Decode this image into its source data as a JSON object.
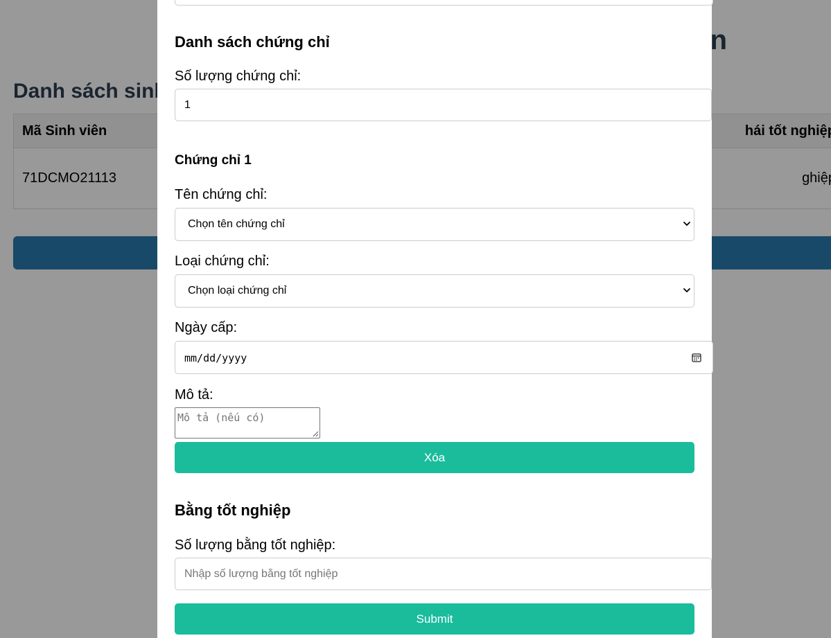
{
  "background": {
    "page_title_fragment": "n",
    "list_title_fragment": "Danh sách sinh",
    "table": {
      "headers": [
        "Mã Sinh viên",
        "hái tốt nghiệp"
      ],
      "rows": [
        [
          "71DCMO21113",
          "ghiệp"
        ]
      ]
    }
  },
  "modal": {
    "certificates": {
      "heading": "Danh sách chứng chỉ",
      "count_label": "Số lượng chứng chỉ:",
      "count_value": "1",
      "item": {
        "heading": "Chứng chỉ 1",
        "name_label": "Tên chứng chỉ:",
        "name_select": "Chọn tên chứng chỉ",
        "type_label": "Loại chứng chỉ:",
        "type_select": "Chọn loại chứng chỉ",
        "date_label": "Ngày cấp:",
        "date_placeholder": "mm/dd/yyyy",
        "desc_label": "Mô tả:",
        "desc_placeholder": "Mô tả (nếu có)",
        "delete_label": "Xóa"
      }
    },
    "diplomas": {
      "heading": "Bằng tốt nghiệp",
      "count_label": "Số lượng bằng tốt nghiệp:",
      "count_placeholder": "Nhập số lượng bằng tốt nghiệp"
    },
    "submit_label": "Submit"
  },
  "colors": {
    "accent": "#1abc9c",
    "background_button": "#2a7ab0",
    "overlay": "rgba(0,0,0,0.4)"
  },
  "icons": [
    "chevron-down-icon",
    "calendar-icon",
    "resize-grip-icon"
  ]
}
